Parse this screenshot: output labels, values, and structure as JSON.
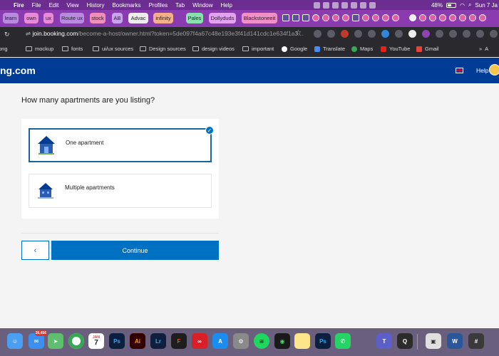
{
  "menubar": {
    "items": [
      "Fire",
      "File",
      "Edit",
      "View",
      "History",
      "Bookmarks",
      "Profiles",
      "Tab",
      "Window",
      "Help"
    ],
    "battery": "48%",
    "datetime": "Sun 7 Ja"
  },
  "tabs": [
    "learn",
    "own",
    "ux",
    "Route ux",
    "stock",
    "AB",
    "Advac",
    "infinity",
    "Pales",
    "Dollyduds",
    "Blackstoneeit"
  ],
  "address": {
    "host": "join.booking.com",
    "path": "/become-a-host/owner.html?token=5de097f4a67c48e193e3f41d141cdc1e634f1a3..."
  },
  "bookmarks": [
    "png",
    "mockup",
    "fonts",
    "ui/ux sources",
    "Design sources",
    "design videos",
    "important",
    "Google",
    "Translate",
    "Maps",
    "YouTube",
    "Gmail",
    "A"
  ],
  "header": {
    "logo": "ng.com",
    "help_label": "Help"
  },
  "page": {
    "question": "How many apartments are you listing?",
    "options": [
      {
        "label": "One apartment",
        "selected": true
      },
      {
        "label": "Multiple apartments",
        "selected": false
      }
    ],
    "back_label": "‹",
    "continue_label": "Continue"
  },
  "dock": {
    "mail_badge": "26,456",
    "calendar_month": "JAN",
    "calendar_day": "7",
    "apps": [
      "Finder",
      "Mail",
      "Maps",
      "Chrome",
      "Calendar",
      "Photoshop",
      "Illustrator",
      "Lightroom",
      "Figma",
      "Creative Cloud",
      "App Store",
      "System Settings",
      "Spotify",
      "Activity Monitor",
      "Notes",
      "Photoshop",
      "WhatsApp",
      "Teams",
      "QuickTime",
      "Preview",
      "Word",
      "Calculator"
    ]
  },
  "colors": {
    "brand": "#003b95",
    "accent": "#0071c2",
    "menubar": "#6b2d8f"
  }
}
